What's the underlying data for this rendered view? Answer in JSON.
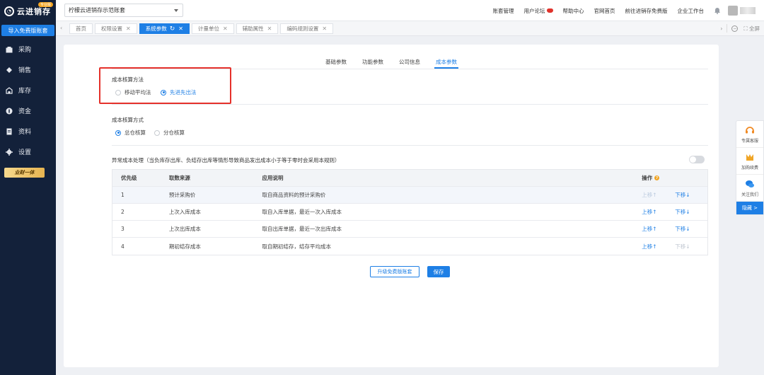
{
  "app": {
    "logo_text": "云进销存",
    "logo_badge": "专业版",
    "import_button": "导入免费版账套",
    "vip_badge": "业财一体"
  },
  "sidebar": {
    "items": [
      {
        "label": "采购",
        "icon": "bag-icon"
      },
      {
        "label": "销售",
        "icon": "diamond-icon"
      },
      {
        "label": "库存",
        "icon": "warehouse-icon"
      },
      {
        "label": "资金",
        "icon": "coin-icon"
      },
      {
        "label": "资料",
        "icon": "document-icon"
      },
      {
        "label": "设置",
        "icon": "gear-icon"
      }
    ]
  },
  "topbar": {
    "account": "柠檬云进销存示范账套",
    "links": [
      "账套管理",
      "用户论坛",
      "帮助中心",
      "官网首页",
      "前往进销存免费版",
      "企业工作台"
    ]
  },
  "tabs": {
    "items": [
      {
        "label": "首页",
        "closable": false
      },
      {
        "label": "权限设置",
        "closable": true
      },
      {
        "label": "系统参数",
        "closable": true,
        "active": true
      },
      {
        "label": "计量单位",
        "closable": true
      },
      {
        "label": "辅助属性",
        "closable": true
      },
      {
        "label": "编码规则设置",
        "closable": true
      }
    ],
    "fullscreen": "全屏"
  },
  "subtabs": [
    "基础参数",
    "功能参数",
    "公司信息",
    "成本参数"
  ],
  "cost_method": {
    "title": "成本核算方法",
    "options": [
      "移动平均法",
      "先进先出法"
    ],
    "selected": 1
  },
  "cost_mode": {
    "title": "成本核算方式",
    "options": [
      "总仓核算",
      "分仓核算"
    ],
    "selected": 0
  },
  "abnormal": {
    "title": "异常成本处理（当负库存出库、负结存出库等情形导致商品发出成本小于等于零时会采用本规则）",
    "enabled": false
  },
  "table": {
    "headers": [
      "优先级",
      "取数来源",
      "应用说明",
      "操作"
    ],
    "rows": [
      {
        "priority": "1",
        "source": "预计采购价",
        "desc": "取自商品资料的预计采购价",
        "up": "上移↑",
        "down": "下移↓",
        "up_disabled": true,
        "down_disabled": false
      },
      {
        "priority": "2",
        "source": "上次入库成本",
        "desc": "取自入库单据，最近一次入库成本",
        "up": "上移↑",
        "down": "下移↓",
        "up_disabled": false,
        "down_disabled": false
      },
      {
        "priority": "3",
        "source": "上次出库成本",
        "desc": "取自出库单据，最近一次出库成本",
        "up": "上移↑",
        "down": "下移↓",
        "up_disabled": false,
        "down_disabled": false
      },
      {
        "priority": "4",
        "source": "期初结存成本",
        "desc": "取自期初结存，结存平均成本",
        "up": "上移↑",
        "down": "下移↓",
        "up_disabled": false,
        "down_disabled": true
      }
    ]
  },
  "buttons": {
    "upgrade": "升级免费版账套",
    "save": "保存"
  },
  "float_panel": {
    "items": [
      "专属客服",
      "加购续费",
      "关注我们"
    ],
    "hide": "隐藏 >"
  },
  "colors": {
    "primary": "#1e7fe5",
    "sidebar": "#13213a",
    "highlight": "#e5312b"
  }
}
